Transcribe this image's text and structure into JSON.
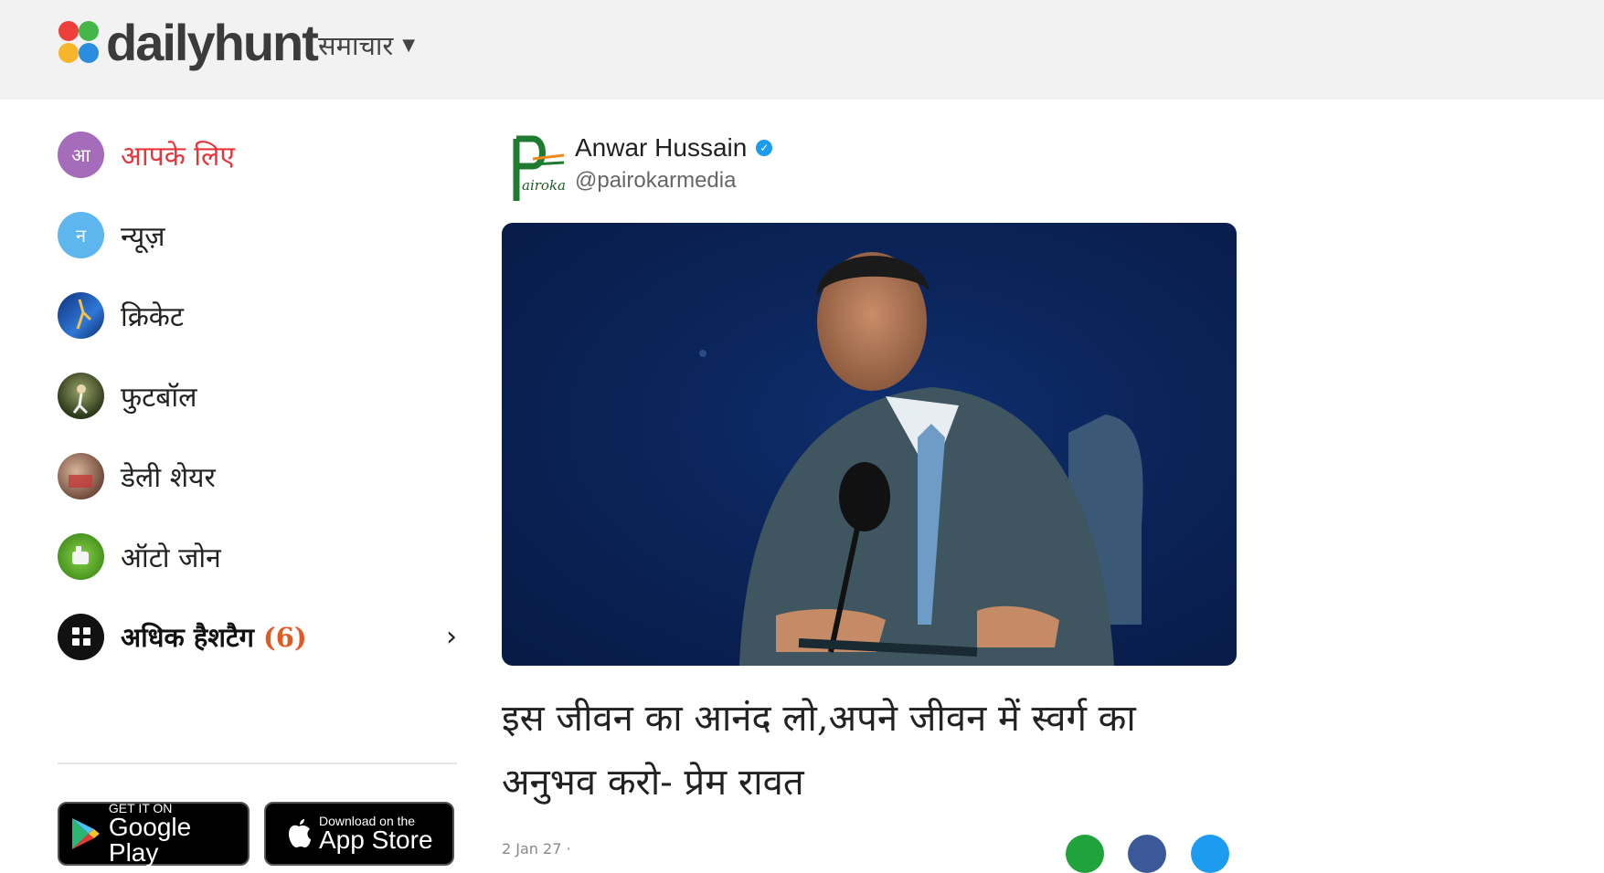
{
  "header": {
    "logo_text": "dailyhunt",
    "menu_label": "समाचार",
    "menu_caret": "▼"
  },
  "sidebar": {
    "items": [
      {
        "avatar": "आ",
        "label": "आपके लिए",
        "color": "#a46cba",
        "active": true
      },
      {
        "avatar": "न",
        "label": "न्यूज़",
        "color": "#5db6ee",
        "active": false
      },
      {
        "avatar": "",
        "label": "क्रिकेट",
        "color": "#1e4fa8",
        "active": false
      },
      {
        "avatar": "",
        "label": "फुटबॉल",
        "color": "#4a5a2a",
        "active": false
      },
      {
        "avatar": "",
        "label": "डेली शेयर",
        "color": "#8a5a4a",
        "active": false
      },
      {
        "avatar": "",
        "label": "ऑटो जोन",
        "color": "#6cc02a",
        "active": false
      }
    ],
    "more": {
      "label": "अधिक हैशटैग",
      "count": "(6)",
      "chevron": "›"
    }
  },
  "stores": {
    "google": {
      "top": "GET IT ON",
      "big": "Google Play"
    },
    "apple": {
      "top": "Download on the",
      "big": "App Store"
    }
  },
  "post": {
    "author_name": "Anwar Hussain",
    "author_handle": "@pairokarmedia",
    "author_logo_text": "airokar",
    "headline": "इस जीवन का आनंद लो,अपने जीवन में स्वर्ग का अनुभव करो- प्रेम रावत",
    "meta": "2 Jan 27 ·",
    "share_colors": [
      "#1fa33a",
      "#3b5998",
      "#1d9bf0"
    ]
  },
  "colors": {
    "accent_red": "#e5363b",
    "header_bg": "#f2f2f2"
  }
}
